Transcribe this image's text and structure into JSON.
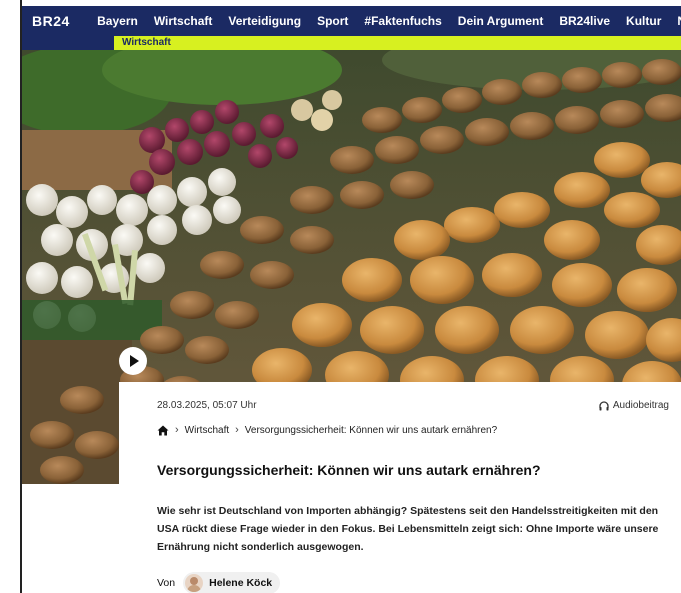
{
  "header": {
    "logo": "BR24",
    "nav_items": [
      "Bayern",
      "Wirtschaft",
      "Verteidigung",
      "Sport",
      "#Faktenfuchs",
      "Dein Argument",
      "BR24live",
      "Kultur",
      "Netz"
    ]
  },
  "subnav": {
    "label": "Wirtschaft"
  },
  "colors": {
    "header_bg": "#1b2a63",
    "accent": "#d7f020"
  },
  "article": {
    "date": "28.03.2025, 05:07 Uhr",
    "audio_label": "Audiobeitrag",
    "breadcrumb": {
      "section": "Wirtschaft",
      "current": "Versorgungssicherheit: Können wir uns autark ernähren?"
    },
    "title": "Versorgungssicherheit: Können wir uns autark ernähren?",
    "teaser": "Wie sehr ist Deutschland von Importen abhängig? Spätestens seit den Handelsstreitigkeiten mit den USA rückt diese Frage wieder in den Fokus. Bei Lebensmitteln zeigt sich: Ohne Importe wäre unsere Ernährung nicht sonderlich ausgewogen.",
    "author_prefix": "Von",
    "author_name": "Helene Köck"
  },
  "icons": {
    "play": "play-icon",
    "audio": "headphone-icon",
    "home": "home-icon",
    "chevron": "chevron-right-icon"
  }
}
